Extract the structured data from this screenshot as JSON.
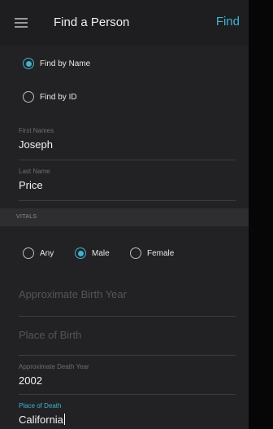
{
  "header": {
    "title": "Find a Person",
    "action": "Find"
  },
  "search_mode": {
    "options": [
      "Find by Name",
      "Find by ID"
    ],
    "selected": "Find by Name"
  },
  "fields": {
    "first_names": {
      "label": "First Names",
      "value": "Joseph"
    },
    "last_name": {
      "label": "Last Name",
      "value": "Price"
    }
  },
  "vitals": {
    "section_label": "VITALS",
    "gender_options": [
      "Any",
      "Male",
      "Female"
    ],
    "gender_selected": "Male",
    "birth_year": {
      "placeholder": "Approximate Birth Year"
    },
    "birth_place": {
      "placeholder": "Place of Birth"
    },
    "death_year": {
      "label": "Approximate Death Year",
      "value": "2002"
    },
    "death_place": {
      "label": "Place of Death",
      "value": "California"
    }
  },
  "colors": {
    "accent": "#3fb2cf",
    "background": "#222224"
  }
}
